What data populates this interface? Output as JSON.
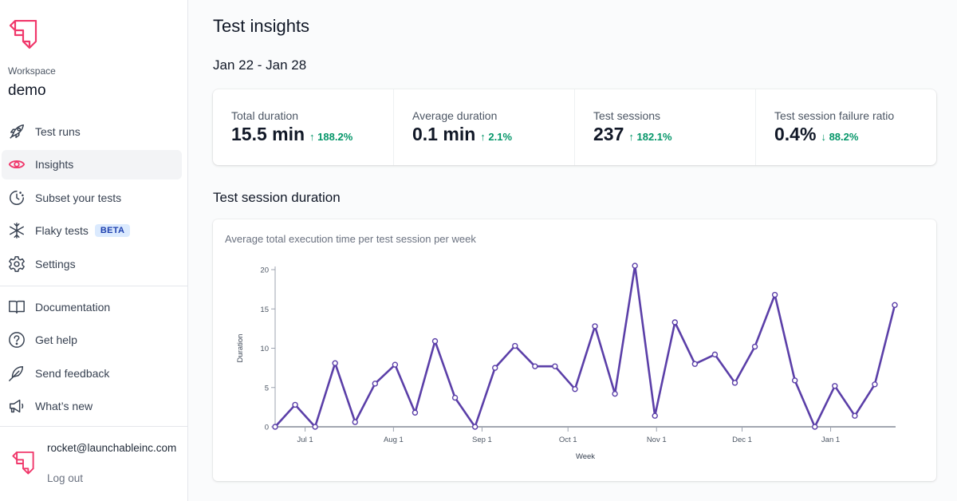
{
  "sidebar": {
    "workspace_label": "Workspace",
    "workspace_name": "demo",
    "nav_primary": [
      {
        "label": "Test runs",
        "icon": "rocket-icon",
        "active": false
      },
      {
        "label": "Insights",
        "icon": "eye-icon",
        "active": true
      },
      {
        "label": "Subset your tests",
        "icon": "clock-icon",
        "active": false
      },
      {
        "label": "Flaky tests",
        "icon": "snowflake-icon",
        "active": false,
        "badge": "BETA"
      },
      {
        "label": "Settings",
        "icon": "gear-icon",
        "active": false
      }
    ],
    "nav_secondary": [
      {
        "label": "Documentation",
        "icon": "book-icon"
      },
      {
        "label": "Get help",
        "icon": "question-icon"
      },
      {
        "label": "Send feedback",
        "icon": "feather-icon"
      },
      {
        "label": "What’s new",
        "icon": "megaphone-icon"
      }
    ],
    "user": {
      "email": "rocket@launchableinc.com",
      "logout_label": "Log out"
    }
  },
  "colors": {
    "brand": "#f0386b",
    "accent_line": "#5b3fa8",
    "positive": "#059669",
    "badge_bg": "#dbeafe",
    "badge_text": "#1e40af"
  },
  "main": {
    "title": "Test insights",
    "date_range": "Jan 22 - Jan 28",
    "stats": [
      {
        "label": "Total duration",
        "value": "15.5 min",
        "change": "188.2%",
        "direction": "up"
      },
      {
        "label": "Average duration",
        "value": "0.1 min",
        "change": "2.1%",
        "direction": "up"
      },
      {
        "label": "Test sessions",
        "value": "237",
        "change": "182.1%",
        "direction": "up"
      },
      {
        "label": "Test session failure ratio",
        "value": "0.4%",
        "change": "88.2%",
        "direction": "down"
      }
    ],
    "section_title": "Test session duration",
    "chart_subtitle": "Average total execution time per test session per week"
  },
  "chart_data": {
    "type": "line",
    "title": "Average total execution time per test session per week",
    "xlabel": "Week",
    "ylabel": "Duration",
    "ylim": [
      0,
      20
    ],
    "yticks": [
      0,
      5,
      10,
      15,
      20
    ],
    "xtick_labels": [
      "Jul 1",
      "Aug 1",
      "Sep 1",
      "Oct 1",
      "Nov 1",
      "Dec 1",
      "Jan 1"
    ],
    "xtick_index_positions": [
      1.5,
      5.92,
      10.35,
      14.65,
      19.08,
      23.36,
      27.79
    ],
    "grid": false,
    "legend": "none",
    "series": [
      {
        "name": "Duration",
        "values": [
          0,
          2.8,
          0,
          8.1,
          0.6,
          5.5,
          7.9,
          1.8,
          10.9,
          3.7,
          0,
          7.5,
          10.3,
          7.7,
          7.7,
          4.8,
          12.8,
          4.2,
          20.5,
          1.4,
          13.3,
          8.0,
          9.2,
          5.6,
          10.2,
          16.8,
          5.9,
          0,
          5.2,
          1.4,
          5.4,
          15.5
        ]
      }
    ]
  }
}
